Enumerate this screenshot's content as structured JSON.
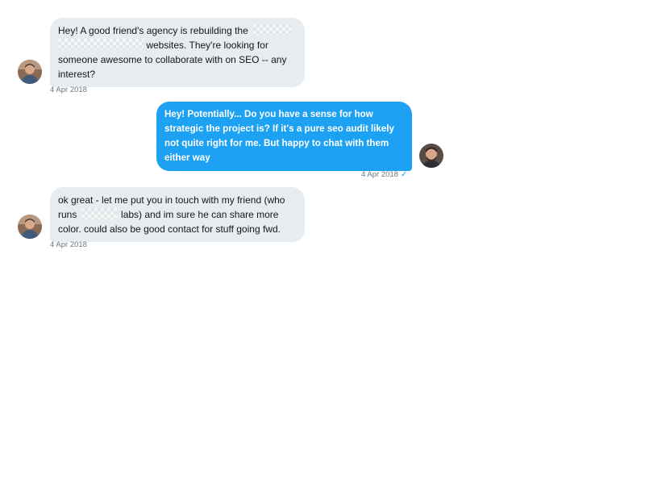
{
  "conversation": {
    "messages": [
      {
        "direction": "incoming",
        "parts": [
          "Hey! A good friend's agency is rebuilding the",
          "websites. They're looking for someone awesome to collaborate with on SEO -- any interest?"
        ],
        "timestamp": "4 Apr 2018"
      },
      {
        "direction": "outgoing",
        "text": "Hey! Potentially... Do you have a sense for how strategic the project is? If it's a pure seo audit likely not quite right for me. But happy to chat with them either way",
        "timestamp": "4 Apr 2018",
        "status_icon": "check-icon"
      },
      {
        "direction": "incoming",
        "parts": [
          "ok great - let me put you in touch with my friend (who runs",
          "labs) and im sure he can share more color. could also be good contact for stuff going fwd."
        ],
        "timestamp": "4 Apr 2018"
      }
    ],
    "colors": {
      "incoming_bubble": "#e6ecf0",
      "outgoing_bubble": "#1da1f2",
      "timestamp": "#657786",
      "read_check": "#1da1f2"
    }
  }
}
